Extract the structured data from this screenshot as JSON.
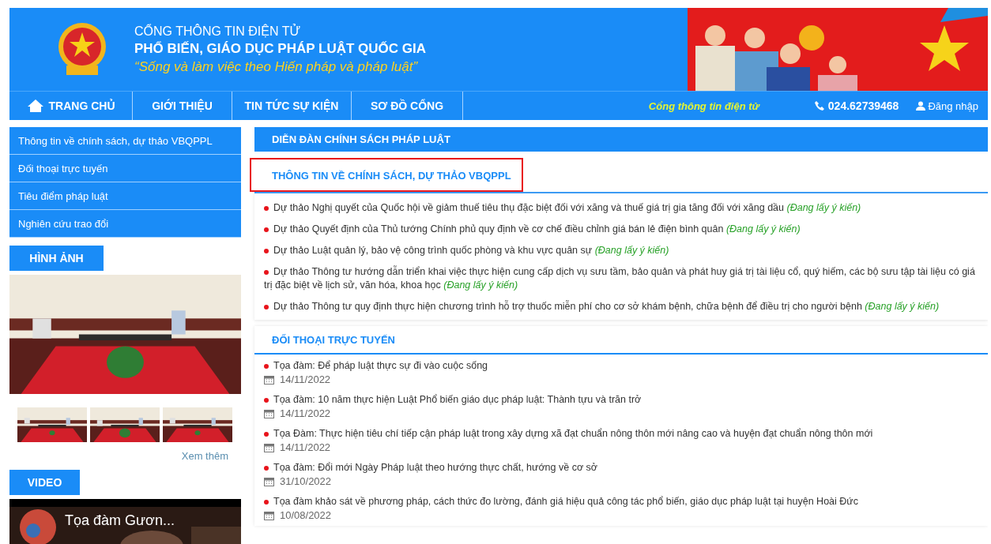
{
  "header": {
    "portal_label": "CỔNG THÔNG TIN ĐIỆN TỬ",
    "title": "PHỔ BIẾN, GIÁO DỤC PHÁP LUẬT QUỐC GIA",
    "slogan": "“Sống và làm việc theo Hiến pháp và pháp luật”"
  },
  "nav": {
    "items": [
      {
        "label": "TRANG CHỦ",
        "kind": "home"
      },
      {
        "label": "GIỚI THIỆU",
        "kind": "plain"
      },
      {
        "label": "TIN TỨC SỰ KIỆN",
        "kind": "plain"
      },
      {
        "label": "SƠ ĐỒ CỔNG",
        "kind": "plain"
      }
    ],
    "tagline": "Cổng thông tin điện tử",
    "phone": "024.62739468",
    "login": "Đăng nhập"
  },
  "sidebar": {
    "menu": [
      "Thông tin về chính sách, dự thảo VBQPPL",
      "Đối thoại trực tuyến",
      "Tiêu điểm pháp luật",
      "Nghiên cứu trao đổi"
    ],
    "gallery": {
      "heading": "HÌNH ẢNH",
      "more_link": "Xem thêm"
    },
    "video": {
      "heading": "VIDEO",
      "title": "Tọa đàm Gươn..."
    }
  },
  "forum": {
    "heading": "DIỄN ĐÀN CHÍNH SÁCH PHÁP LUẬT",
    "policy": {
      "tab": {
        "label": "THÔNG TIN VỀ CHÍNH SÁCH, DỰ THẢO VBQPPL",
        "selected": true
      },
      "items": [
        {
          "text": "Dự thảo Nghị quyết của Quốc hội về giảm thuế tiêu thụ đặc biệt đối với xăng và thuế giá trị gia tăng đối với xăng dầu",
          "status": "(Đang lấy ý kiến)"
        },
        {
          "text": "Dự thảo Quyết định của Thủ tướng Chính phủ quy định về cơ chế điều chỉnh giá bán lẻ điện bình quân",
          "status": "(Đang lấy ý kiến)"
        },
        {
          "text": "Dự thảo Luật quản lý, bảo vệ công trình quốc phòng và khu vực quân sự",
          "status": "(Đang lấy ý kiến)"
        },
        {
          "text": "Dự thảo Thông tư hướng dẫn triển khai việc thực hiện cung cấp dịch vụ sưu tầm, bảo quản và phát huy giá trị tài liệu cổ, quý hiếm, các bộ sưu tập tài liệu có giá trị đặc biệt về lịch sử, văn hóa, khoa học",
          "status": "(Đang lấy ý kiến)"
        },
        {
          "text": "Dự thảo Thông tư quy định thực hiện chương trình hỗ trợ thuốc miễn phí cho cơ sở khám bệnh, chữa bệnh để điều trị cho người bệnh",
          "status": "(Đang lấy ý kiến)"
        }
      ]
    },
    "dialogue": {
      "heading": "ĐỐI THOẠI TRỰC TUYẾN",
      "items": [
        {
          "title": "Tọa đàm: Để pháp luật thực sự đi vào cuộc sống",
          "date": "14/11/2022"
        },
        {
          "title": "Tọa đàm: 10 năm thực hiện Luật Phổ biến giáo dục pháp luật: Thành tựu và trăn trở",
          "date": "14/11/2022"
        },
        {
          "title": "Tọa Đàm: Thực hiện tiêu chí tiếp cận pháp luật trong xây dựng xã đạt chuẩn nông thôn mới nâng cao và huyện đạt chuẩn nông thôn mới",
          "date": "14/11/2022"
        },
        {
          "title": "Tọa đàm: Đổi mới Ngày Pháp luật theo hướng thực chất, hướng về cơ sở",
          "date": "31/10/2022"
        },
        {
          "title": "Tọa đàm khảo sát về phương pháp, cách thức đo lường, đánh giá hiệu quả công tác phổ biến, giáo dục pháp luật tại huyện Hoài Đức",
          "date": "10/08/2022"
        }
      ]
    }
  }
}
